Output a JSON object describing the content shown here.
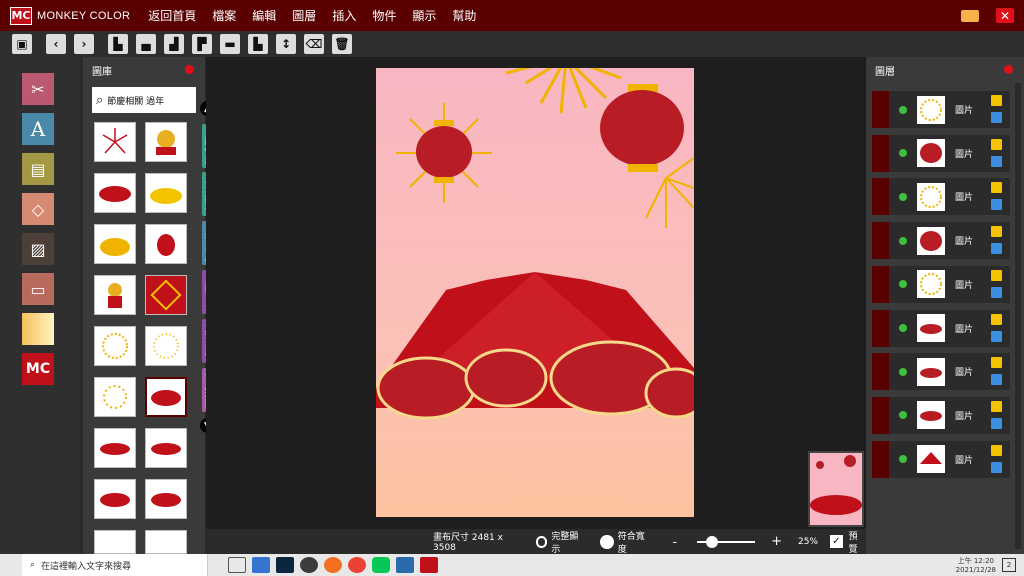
{
  "app": {
    "logo": "MC",
    "brand": "MONKEY COLOR"
  },
  "menu": [
    "返回首頁",
    "檔案",
    "編輯",
    "圖層",
    "插入",
    "物件",
    "顯示",
    "幫助"
  ],
  "gallery": {
    "title": "圖庫",
    "search_value": "節慶相關 過年"
  },
  "categories": [
    "即時快訊",
    "小城故事",
    "台灣專屬",
    "人間百景",
    "文字藝術",
    "節慶相關"
  ],
  "layers": {
    "title": "圖層",
    "items": [
      {
        "label": "圖片",
        "kind": "fireworks"
      },
      {
        "label": "圖片",
        "kind": "lantern"
      },
      {
        "label": "圖片",
        "kind": "fireworks"
      },
      {
        "label": "圖片",
        "kind": "lantern"
      },
      {
        "label": "圖片",
        "kind": "fireworks"
      },
      {
        "label": "圖片",
        "kind": "cloud"
      },
      {
        "label": "圖片",
        "kind": "cloud"
      },
      {
        "label": "圖片",
        "kind": "cloud"
      },
      {
        "label": "圖片",
        "kind": "fan"
      }
    ]
  },
  "bottom": {
    "canvas_size": "畫布尺寸 2481 x 3508",
    "full_display": "完整顯示",
    "fit_width": "符合寬度",
    "zoom_minus": "-",
    "zoom_plus": "+",
    "zoom": "25%",
    "preview": "預覽",
    "zoom_level": 0.25
  },
  "taskbar": {
    "search_placeholder": "在這裡輸入文字來搜尋",
    "time": "上午 12:20",
    "date": "2021/12/28",
    "notifications": "2"
  },
  "colors": {
    "title_bar": "#5a0000",
    "accent_red": "#c0101a",
    "poster_top": "#f8b6c2",
    "poster_bottom": "#fdc39f"
  },
  "tool_icons": [
    "save-icon",
    "undo-icon",
    "redo-icon",
    "align-left-icon",
    "align-center-icon",
    "align-right-icon",
    "align-top-icon",
    "align-middle-icon",
    "align-bottom-icon",
    "distribute-icon",
    "eraser-icon",
    "trash-icon"
  ],
  "side_tools": [
    "crop-tool-icon",
    "text-tool-icon",
    "paper-tool-icon",
    "shapes-tool-icon",
    "image-tool-icon",
    "frame-tool-icon",
    "gradient-tool-icon",
    "mc-logo-icon"
  ]
}
